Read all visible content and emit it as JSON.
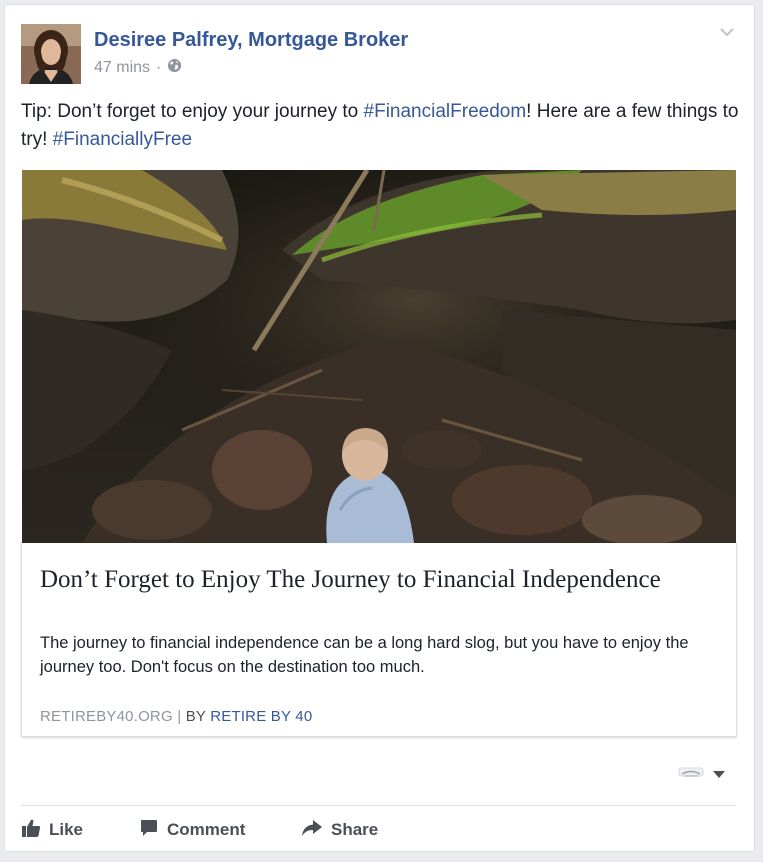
{
  "post": {
    "author": "Desiree Palfrey, Mortgage Broker",
    "time": "47 mins",
    "separator": "·",
    "text": {
      "prefix": "Tip: Don’t forget to enjoy your journey to ",
      "hashtag1": "#FinancialFreedom",
      "middle": "! Here are a few things to try! ",
      "hashtag2": "#FinanciallyFree"
    },
    "link": {
      "title": "Don’t Forget to Enjoy The Journey to Financial Independence",
      "description": "The journey to financial independence can be a long hard slog, but you have to enjoy the journey too. Don't focus on the destination too much.",
      "domain": "RETIREBY40.ORG",
      "pipe": "|",
      "by_label": "BY",
      "by_author": "RETIRE BY 40"
    },
    "actions": {
      "like": "Like",
      "comment": "Comment",
      "share": "Share"
    }
  },
  "icons": {
    "privacy": "globe-icon",
    "options": "chevron-down-icon",
    "like": "thumbs-up-icon",
    "comment": "comment-icon",
    "share": "share-arrow-icon"
  },
  "colors": {
    "link_blue": "#365899",
    "meta_gray": "#90949c",
    "action_gray": "#4b4f56",
    "text": "#1d2129"
  }
}
